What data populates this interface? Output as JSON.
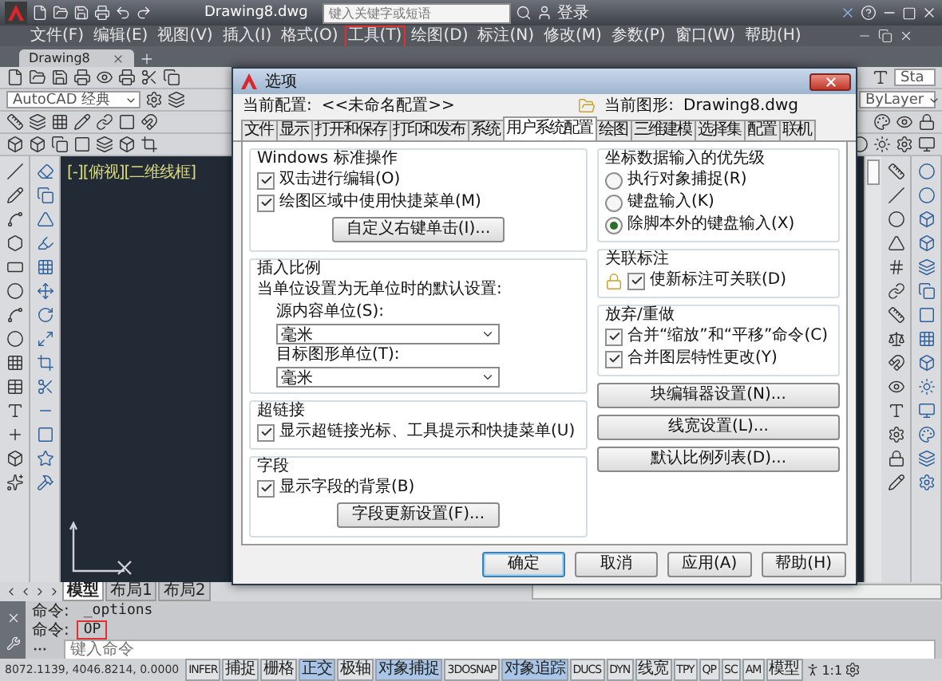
{
  "window": {
    "title": "Drawing8.dwg",
    "search_placeholder": "键入关键字或短语",
    "login": "登录"
  },
  "menu": [
    {
      "label": "文件(F)",
      "highlighted": false
    },
    {
      "label": "编辑(E)",
      "highlighted": false
    },
    {
      "label": "视图(V)",
      "highlighted": false
    },
    {
      "label": "插入(I)",
      "highlighted": false
    },
    {
      "label": "格式(O)",
      "highlighted": false
    },
    {
      "label": "工具(T)",
      "highlighted": true
    },
    {
      "label": "绘图(D)",
      "highlighted": false
    },
    {
      "label": "标注(N)",
      "highlighted": false
    },
    {
      "label": "修改(M)",
      "highlighted": false
    },
    {
      "label": "参数(P)",
      "highlighted": false
    },
    {
      "label": "窗口(W)",
      "highlighted": false
    },
    {
      "label": "帮助(H)",
      "highlighted": false
    }
  ],
  "document_tabs": [
    {
      "label": "Drawing8",
      "selected": true
    }
  ],
  "toolbar": {
    "workspace": "AutoCAD 经典",
    "layer": "ByLayer",
    "style": "Sta"
  },
  "viewport": {
    "label": "[-][俯视][二维线框]"
  },
  "layout_tabs": [
    {
      "label": "模型",
      "selected": true
    },
    {
      "label": "布局1",
      "selected": false
    },
    {
      "label": "布局2",
      "selected": false
    }
  ],
  "command_history": [
    {
      "prompt": "命令:",
      "text": "_options",
      "highlighted": false
    },
    {
      "prompt": "命令:",
      "text": "OP",
      "highlighted": true
    }
  ],
  "command_input": {
    "placeholder": "键入命令"
  },
  "status_bar": {
    "coordinates": "8072.1139, 4046.8214, 0.0000",
    "toggles": [
      {
        "label": "INFER",
        "on": false
      },
      {
        "label": "捕捉",
        "on": false
      },
      {
        "label": "栅格",
        "on": false
      },
      {
        "label": "正交",
        "on": true
      },
      {
        "label": "极轴",
        "on": false
      },
      {
        "label": "对象捕捉",
        "on": true
      },
      {
        "label": "3DOSNAP",
        "on": false
      },
      {
        "label": "对象追踪",
        "on": true
      },
      {
        "label": "DUCS",
        "on": false
      },
      {
        "label": "DYN",
        "on": false
      },
      {
        "label": "线宽",
        "on": false
      },
      {
        "label": "TPY",
        "on": false
      },
      {
        "label": "QP",
        "on": false
      },
      {
        "label": "SC",
        "on": false
      },
      {
        "label": "AM",
        "on": false
      }
    ],
    "model": "模型",
    "scale": "1:1"
  },
  "dialog": {
    "title": "选项",
    "profile_label": "当前配置:",
    "profile": "<<未命名配置>>",
    "drawing_label": "当前图形:",
    "drawing": "Drawing8.dwg",
    "tabs": [
      {
        "label": "文件",
        "selected": false
      },
      {
        "label": "显示",
        "selected": false
      },
      {
        "label": "打开和保存",
        "selected": false
      },
      {
        "label": "打印和发布",
        "selected": false
      },
      {
        "label": "系统",
        "selected": false
      },
      {
        "label": "用户系统配置",
        "selected": true
      },
      {
        "label": "绘图",
        "selected": false
      },
      {
        "label": "三维建模",
        "selected": false
      },
      {
        "label": "选择集",
        "selected": false
      },
      {
        "label": "配置",
        "selected": false
      },
      {
        "label": "联机",
        "selected": false
      }
    ],
    "groups_left": [
      {
        "title": "Windows 标准操作",
        "items": [
          {
            "kind": "checkbox",
            "label": "双击进行编辑(O)",
            "checked": true
          },
          {
            "kind": "checkbox",
            "label": "绘图区域中使用快捷菜单(M)",
            "checked": true
          },
          {
            "kind": "button",
            "label": "自定义右键单击(I)..."
          }
        ]
      },
      {
        "title": "插入比例",
        "items": [
          {
            "kind": "label",
            "label": "当单位设置为无单位时的默认设置:"
          },
          {
            "kind": "field_label",
            "label": "源内容单位(S):"
          },
          {
            "kind": "select",
            "value": "毫米"
          },
          {
            "kind": "field_label",
            "label": "目标图形单位(T):"
          },
          {
            "kind": "select",
            "value": "毫米"
          }
        ]
      },
      {
        "title": "超链接",
        "items": [
          {
            "kind": "checkbox",
            "label": "显示超链接光标、工具提示和快捷菜单(U)",
            "checked": true
          }
        ]
      },
      {
        "title": "字段",
        "items": [
          {
            "kind": "checkbox",
            "label": "显示字段的背景(B)",
            "checked": true
          },
          {
            "kind": "button",
            "label": "字段更新设置(F)..."
          }
        ]
      }
    ],
    "groups_right": [
      {
        "title": "坐标数据输入的优先级",
        "items": [
          {
            "kind": "radio",
            "label": "执行对象捕捉(R)",
            "selected": false
          },
          {
            "kind": "radio",
            "label": "键盘输入(K)",
            "selected": false
          },
          {
            "kind": "radio",
            "label": "除脚本外的键盘输入(X)",
            "selected": true
          }
        ]
      },
      {
        "title": "关联标注",
        "items": [
          {
            "kind": "icon_checkbox",
            "label": "使新标注可关联(D)",
            "checked": true
          }
        ]
      },
      {
        "title": "放弃/重做",
        "items": [
          {
            "kind": "checkbox",
            "label": "合并“缩放”和“平移”命令(C)",
            "checked": true
          },
          {
            "kind": "checkbox",
            "label": "合并图层特性更改(Y)",
            "checked": true
          }
        ]
      }
    ],
    "buttons_right": [
      "块编辑器设置(N)...",
      "线宽设置(L)...",
      "默认比例列表(D)..."
    ],
    "footer_buttons": [
      {
        "label": "确定",
        "default": true
      },
      {
        "label": "取消",
        "default": false
      },
      {
        "label": "应用(A)",
        "default": false
      },
      {
        "label": "帮助(H)",
        "default": false
      }
    ]
  }
}
